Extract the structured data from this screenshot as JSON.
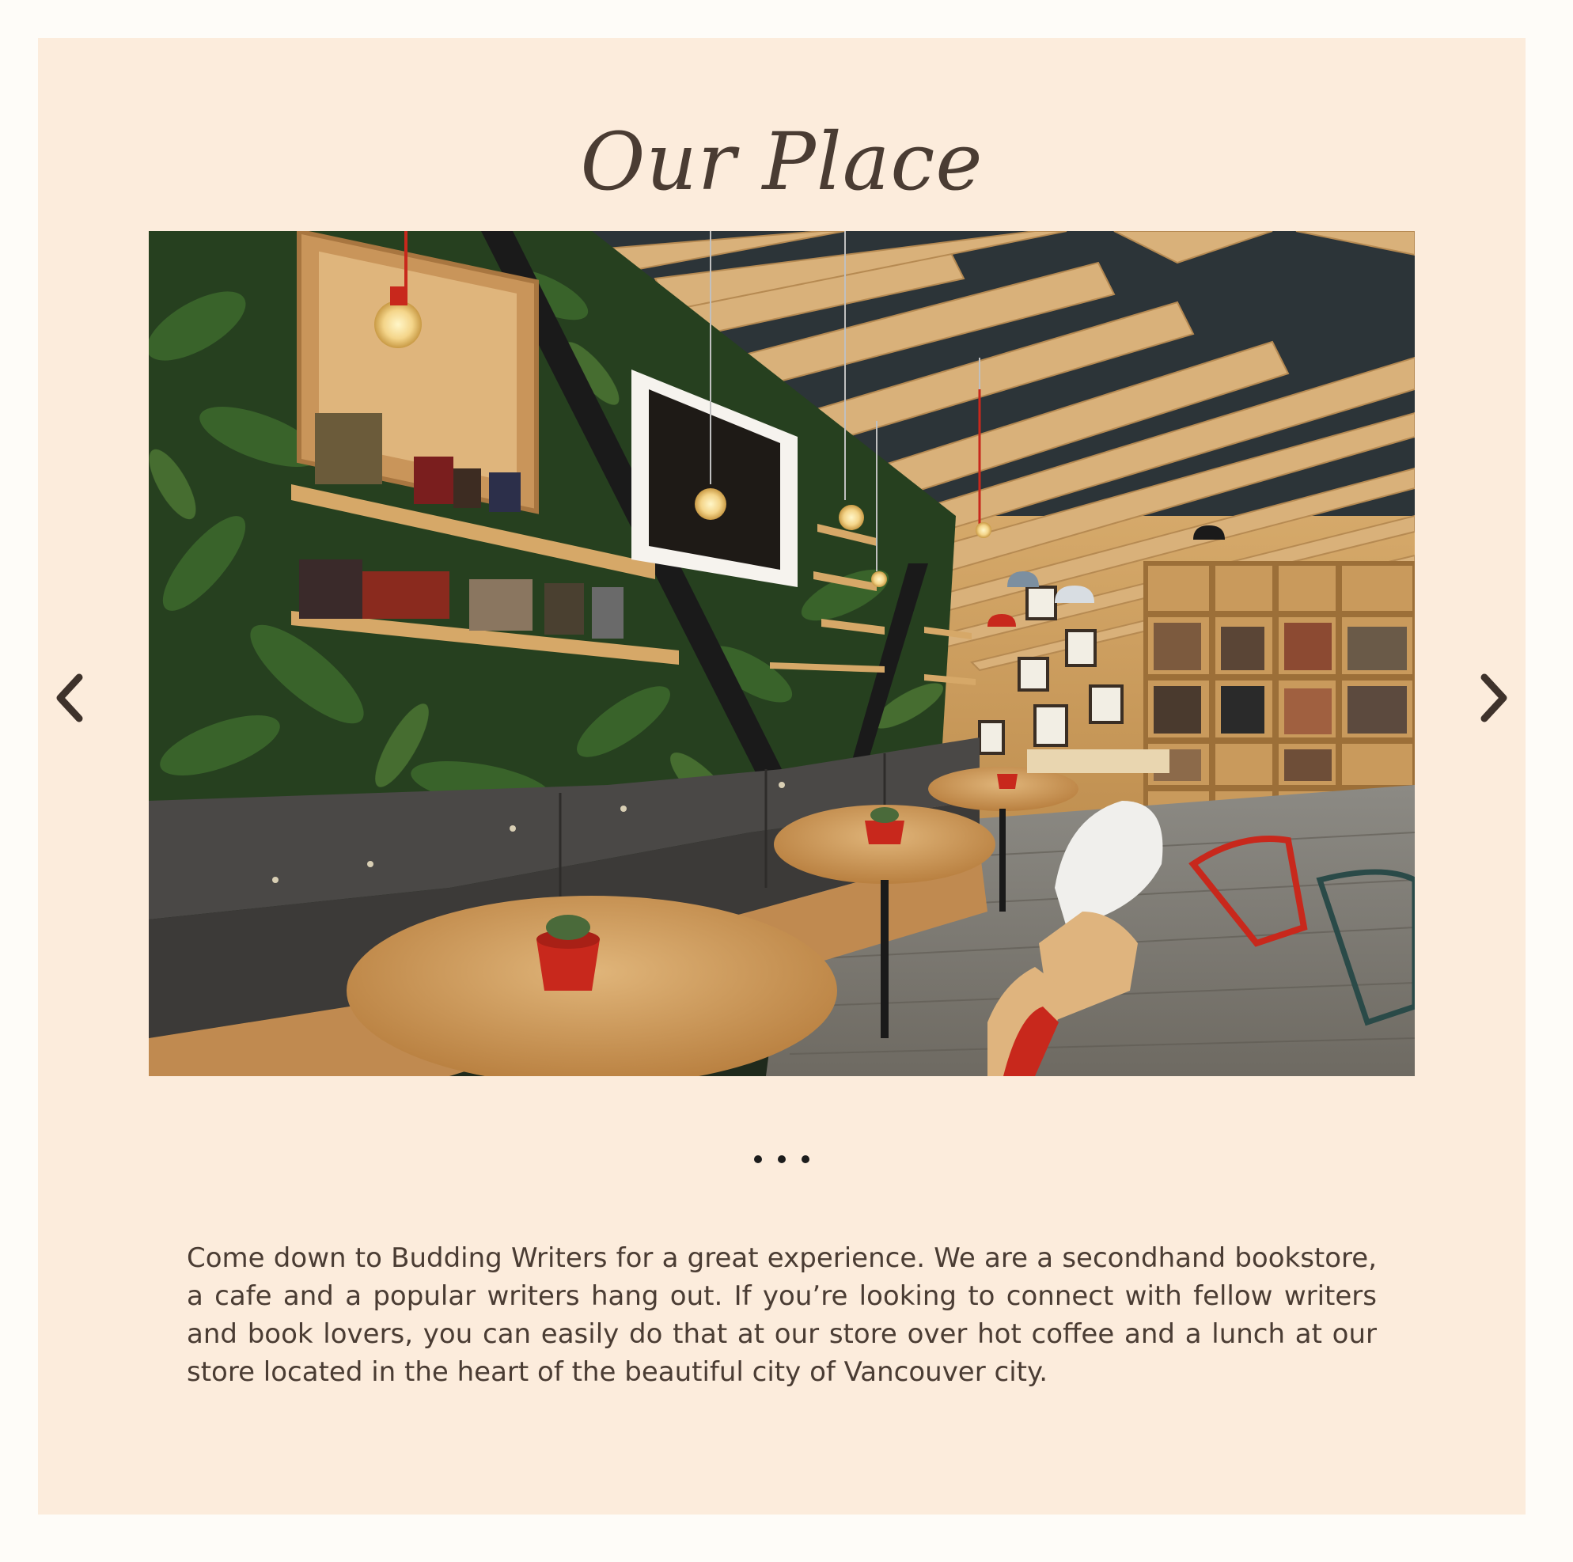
{
  "section": {
    "title": "Our Place",
    "description": "Come down to Budding Writers for a great experience. We are a secondhand bookstore, a cafe and a popular writers hang out. If you’re looking to connect with fellow writers and book lovers, you can easily do that at our store over hot coffee and a lunch at our store located in the heart of the beautiful city of Vancouver city."
  },
  "carousel": {
    "slide_alt": "Cafe interior with green plant wall, bookshelves, wooden ceiling slats, sofa and round wooden tables",
    "prev_icon": "chevron-left-icon",
    "next_icon": "chevron-right-icon",
    "slide_count": 3,
    "active_index": 0
  },
  "colors": {
    "page_background": "#fefcf8",
    "panel_background": "#fcecdc",
    "text": "#4a3c33",
    "dot": "#1c1c1c"
  }
}
